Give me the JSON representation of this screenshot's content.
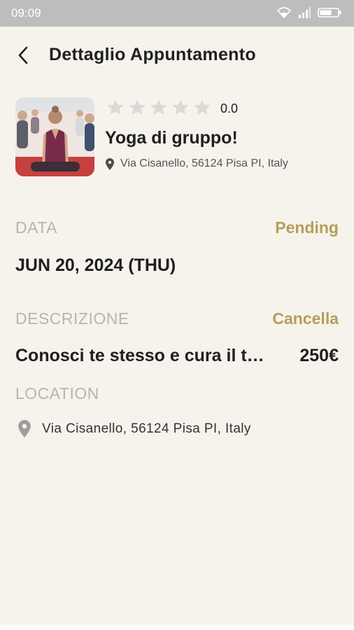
{
  "status_bar": {
    "time": "09:09"
  },
  "header": {
    "title": "Dettaglio Appuntamento"
  },
  "service": {
    "rating": "0.0",
    "stars_filled": 0,
    "stars_total": 5,
    "name": "Yoga di gruppo!",
    "address": "Via Cisanello, 56124 Pisa PI, Italy"
  },
  "data_section": {
    "label": "DATA",
    "status": "Pending",
    "value": "JUN 20, 2024 (THU)"
  },
  "description_section": {
    "label": "DESCRIZIONE",
    "action": "Cancella",
    "text": "Conosci te stesso e cura il t…",
    "price": "250€"
  },
  "location_section": {
    "label": "LOCATION",
    "address": "Via Cisanello, 56124 Pisa PI, Italy"
  },
  "colors": {
    "accent": "#b79d5a",
    "background": "#f6f3ec",
    "muted_label": "#b9b4ad",
    "status_bar": "#bdbdbd"
  }
}
